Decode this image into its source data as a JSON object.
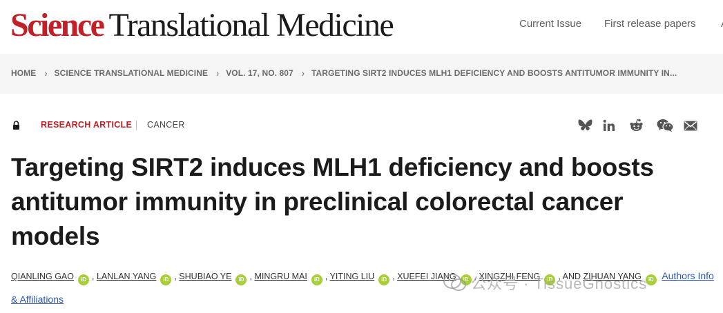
{
  "header": {
    "logo_science": "Science",
    "logo_rest": "Translational Medicine",
    "nav": [
      "Current Issue",
      "First release papers",
      "A"
    ]
  },
  "breadcrumb": [
    "HOME",
    "SCIENCE TRANSLATIONAL MEDICINE",
    "VOL. 17, NO. 807",
    "TARGETING SIRT2 INDUCES MLH1 DEFICIENCY AND BOOSTS ANTITUMOR IMMUNITY IN..."
  ],
  "meta": {
    "article_type": "RESEARCH ARTICLE",
    "subject": "CANCER"
  },
  "share_icons": [
    "bluesky-icon",
    "linkedin-icon",
    "reddit-icon",
    "wechat-icon",
    "email-icon"
  ],
  "article": {
    "title": "Targeting SIRT2 induces MLH1 deficiency and boosts antitumor immunity in preclinical colorectal cancer models"
  },
  "authors": {
    "list": [
      "QIANLING GAO",
      "LANLAN YANG",
      "SHUBIAO YE",
      "MINGRU MAI",
      "YITING LIU",
      "XUEFEI JIANG",
      "XINGZHI FENG",
      "ZIHUAN YANG"
    ],
    "and_text": ", AND",
    "orcid_label": "iD",
    "info_link_1": "Authors Info",
    "info_link_2": "& Affiliations"
  },
  "watermark": {
    "text": "公众号 · TissueGnostics"
  },
  "colors": {
    "brand_red": "#c02026",
    "orcid_green": "#a6ce39",
    "link_blue": "#2b56b8"
  }
}
